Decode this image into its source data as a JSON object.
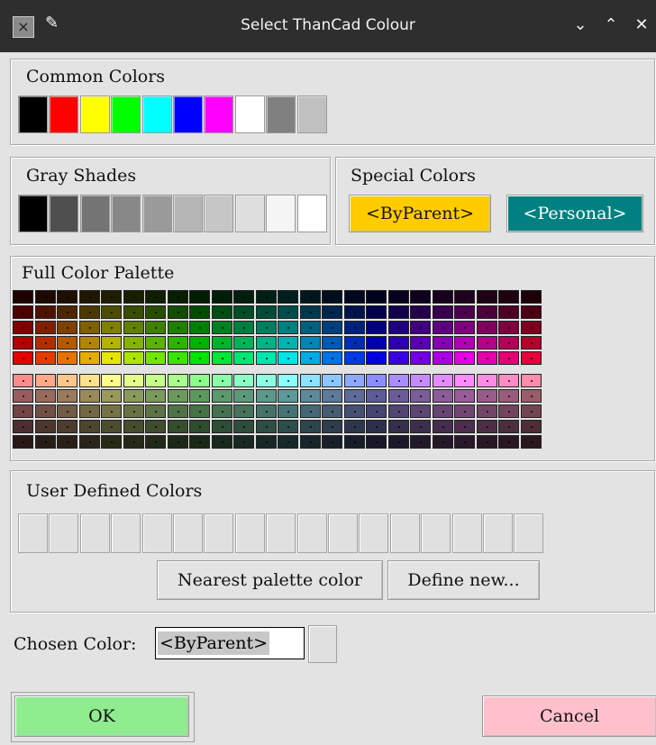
{
  "window": {
    "title": "Select ThanCad Colour",
    "app_icon": "x-app-icon"
  },
  "common_colors": {
    "label": "Common Colors",
    "swatches": [
      "#000000",
      "#ff0000",
      "#ffff00",
      "#00ff00",
      "#00ffff",
      "#0000ff",
      "#ff00ff",
      "#ffffff",
      "#808080",
      "#c0c0c0"
    ]
  },
  "gray_shades": {
    "label": "Gray Shades",
    "swatches": [
      "#000000",
      "#4f4f4f",
      "#747474",
      "#888888",
      "#9a9a9a",
      "#b5b5b5",
      "#c6c6c6",
      "#dedede",
      "#f5f5f5",
      "#ffffff"
    ]
  },
  "special_colors": {
    "label": "Special Colors",
    "by_parent": {
      "label": "<ByParent>",
      "color": "#ffcc00"
    },
    "personal": {
      "label": "<Personal>",
      "color": "#008080"
    }
  },
  "full_palette": {
    "label": "Full Color Palette",
    "hues": 24,
    "bright_rows": [
      {
        "saturation": 1.0,
        "value": 0.12
      },
      {
        "saturation": 1.0,
        "value": 0.3
      },
      {
        "saturation": 1.0,
        "value": 0.5
      },
      {
        "saturation": 1.0,
        "value": 0.7
      },
      {
        "saturation": 1.0,
        "value": 0.9
      }
    ],
    "pastel_rows": [
      {
        "saturation": 0.45,
        "value": 1.0
      },
      {
        "saturation": 0.4,
        "value": 0.6
      },
      {
        "saturation": 0.4,
        "value": 0.45
      },
      {
        "saturation": 0.4,
        "value": 0.3
      },
      {
        "saturation": 0.4,
        "value": 0.16
      }
    ]
  },
  "user_defined": {
    "label": "User Defined Colors",
    "slots": 17,
    "nearest_button": "Nearest palette color",
    "define_button": "Define new..."
  },
  "chosen": {
    "label": "Chosen Color:",
    "value": "<ByParent>"
  },
  "buttons": {
    "ok": {
      "label": "OK",
      "color": "#8fec8f"
    },
    "cancel": {
      "label": "Cancel",
      "color": "#ffc0cb"
    }
  }
}
